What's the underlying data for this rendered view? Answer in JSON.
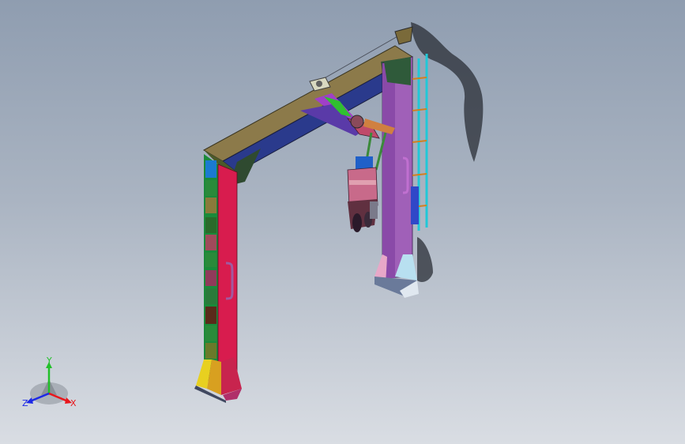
{
  "triad": {
    "x_label": "X",
    "y_label": "Y",
    "z_label": "Z",
    "colors": {
      "x": "#e8161c",
      "y": "#22c02a",
      "z": "#1c28e6"
    }
  },
  "viewport": {
    "background_top": "#8f9db0",
    "background_bottom": "#d9dde3"
  },
  "model_icons": [
    "gantry-frame",
    "hanging-tool-head",
    "ladder",
    "shadow"
  ]
}
